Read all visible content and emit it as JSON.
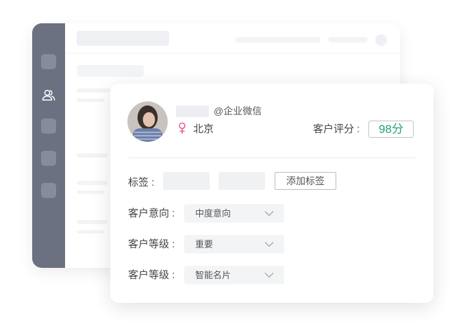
{
  "header": {
    "wecom_tag": "@企业微信",
    "city": "北京",
    "score_label": "客户评分 :",
    "score_value": "98分"
  },
  "tags": {
    "label": "标签 :",
    "add_button": "添加标签"
  },
  "fields": [
    {
      "label": "客户意向 :",
      "value": "中度意向"
    },
    {
      "label": "客户等级 :",
      "value": "重要"
    },
    {
      "label": "客户等级 :",
      "value": "智能名片"
    }
  ],
  "colors": {
    "sidebar": "#6b7180",
    "score": "#1fa27c",
    "gender_female": "#e6609a"
  },
  "icons": {
    "sidebar_active": "users-icon",
    "gender": "female-icon",
    "dropdown": "chevron-down-icon"
  }
}
